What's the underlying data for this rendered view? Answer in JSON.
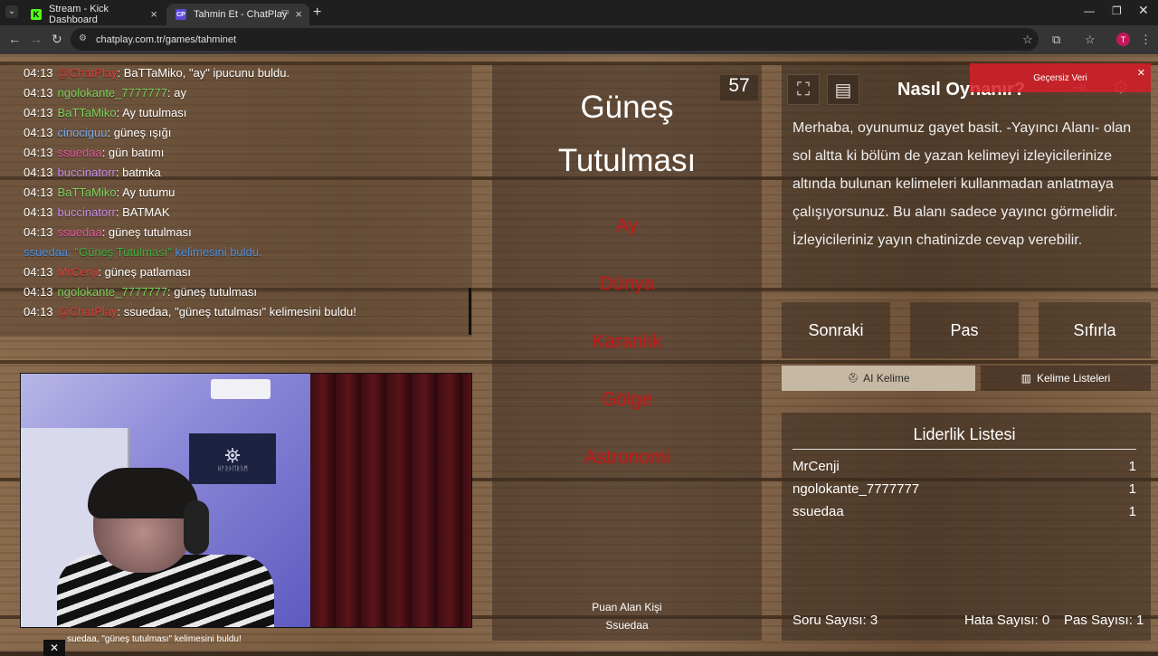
{
  "browser": {
    "tabs": [
      {
        "title": "Stream - Kick Dashboard",
        "favicon": "K"
      },
      {
        "title": "Tahmin Et - ChatPlay",
        "favicon": "CP"
      }
    ],
    "url": "chatplay.com.tr/games/tahminet",
    "profile_initial": "T"
  },
  "chat": {
    "lines": [
      {
        "time": "04:13",
        "user": "@ChatPlay",
        "user_color": "red",
        "text": ": BaTTaMiko, \"ay\" ipucunu buldu."
      },
      {
        "time": "04:13",
        "user": "ngolokante_7777777",
        "user_color": "green",
        "text": ": ay"
      },
      {
        "time": "04:13",
        "user": "BaTTaMiko",
        "user_color": "green",
        "text": ": Ay tutulması"
      },
      {
        "time": "04:13",
        "user": "cinociguu",
        "user_color": "blue",
        "text": ": güneş ışığı"
      },
      {
        "time": "04:13",
        "user": "ssuedaa",
        "user_color": "pink",
        "text": ": gün batımı"
      },
      {
        "time": "04:13",
        "user": "buccinatorr",
        "user_color": "purple",
        "text": ": batmka"
      },
      {
        "time": "04:13",
        "user": "BaTTaMiko",
        "user_color": "green",
        "text": ": Ay tutumu"
      },
      {
        "time": "04:13",
        "user": "buccinatorr",
        "user_color": "purple",
        "text": ": BATMAK"
      },
      {
        "time": "04:13",
        "user": "ssuedaa",
        "user_color": "pink",
        "text": ": güneş tutulması"
      },
      {
        "time": "04:13",
        "user": "MrCenji",
        "user_color": "red",
        "text": ": güneş patlaması"
      },
      {
        "time": "04:13",
        "user": "ngolokante_7777777",
        "user_color": "green",
        "text": ": güneş tutulması"
      },
      {
        "time": "04:13",
        "user": "@ChatPlay",
        "user_color": "red",
        "text": ": ssuedaa, \"güneş tutulması\" kelimesini buldu!"
      }
    ],
    "system": {
      "user": "ssuedaa",
      "word": "\"Güneş Tutulması\"",
      "suffix": "kelimesini buldu."
    }
  },
  "webcam": {
    "flag_text": "ᚺᚨᚱᚦᛖᚱᚢᛗ"
  },
  "game": {
    "word_line1": "Güneş",
    "word_line2": "Tutulması",
    "timer": "57",
    "taboo": [
      "Ay",
      "Dünya",
      "Karanlık",
      "Gölge",
      "Astronomi"
    ],
    "scorer_label": "Puan Alan Kişi",
    "scorer_name": "Ssuedaa"
  },
  "howto": {
    "title": "Nasıl Oynanır?",
    "text": "Merhaba, oyunumuz gayet basit. -Yayıncı Alanı- olan sol altta ki bölüm de yazan kelimeyi izleyicilerinize altında bulunan kelimeleri kullanmadan anlatmaya çalışıyorsunuz. Bu alanı sadece yayıncı görmelidir. İzleyicileriniz yayın chatinizde cevap verebilir."
  },
  "toast": {
    "text": "Geçersiz Veri"
  },
  "actions": {
    "next": "Sonraki",
    "pass": "Pas",
    "reset": "Sıfırla",
    "ai_word": "AI Kelime",
    "word_lists": "Kelime Listeleri"
  },
  "leaderboard": {
    "title": "Liderlik Listesi",
    "rows": [
      {
        "name": "MrCenji",
        "points": "1"
      },
      {
        "name": "ngolokante_7777777",
        "points": "1"
      },
      {
        "name": "ssuedaa",
        "points": "1"
      }
    ]
  },
  "stats": {
    "questions": "Soru Sayısı: 3",
    "errors": "Hata Sayısı: 0",
    "passes": "Pas Sayısı: 1"
  },
  "ticker": {
    "text": "suedaa, \"güneş tutulması\" kelimesini buldu!"
  },
  "colors": {
    "taboo_red": "#d01313",
    "toast_red": "#d71e28",
    "profile": "#c2185b"
  }
}
